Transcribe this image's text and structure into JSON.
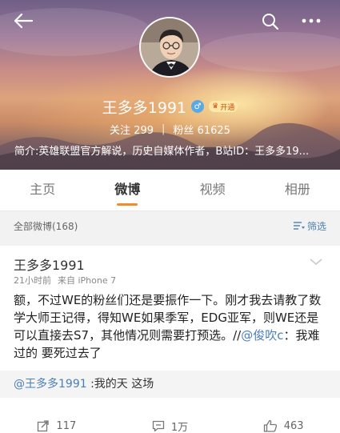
{
  "header": {
    "username": "王多多1991",
    "vip_badge_label": "开通",
    "following_label": "关注",
    "following_count": "299",
    "followers_label": "粉丝",
    "followers_count": "61625",
    "stats_separator": "|",
    "bio": "简介:英雄联盟官方解说，历史自媒体作者，B站ID：王多多19..."
  },
  "tabs": [
    {
      "label": "主页"
    },
    {
      "label": "微博"
    },
    {
      "label": "视频"
    },
    {
      "label": "相册"
    }
  ],
  "filter_bar": {
    "count_label": "全部微博(168)",
    "filter_label": "筛选"
  },
  "post": {
    "author": "王多多1991",
    "time": "21小时前",
    "source": "来自 iPhone 7",
    "body_main": "额，不过WE的粉丝们还是要振作一下。刚才我去请教了数学大师王记得，得知WE如果季军，EDG亚军，则WE还是可以直接去S7，其他情况则需要打预选。//",
    "body_mention": "@俊吹c",
    "body_tail": "：我难过的 要死过去了",
    "repost_mention": "@王多多1991",
    "repost_text": " :我的天 这场",
    "repost_count": "117",
    "comment_count": "1万",
    "like_count": "463"
  },
  "colors": {
    "accent": "#f28c28",
    "link": "#4a7fb8"
  }
}
